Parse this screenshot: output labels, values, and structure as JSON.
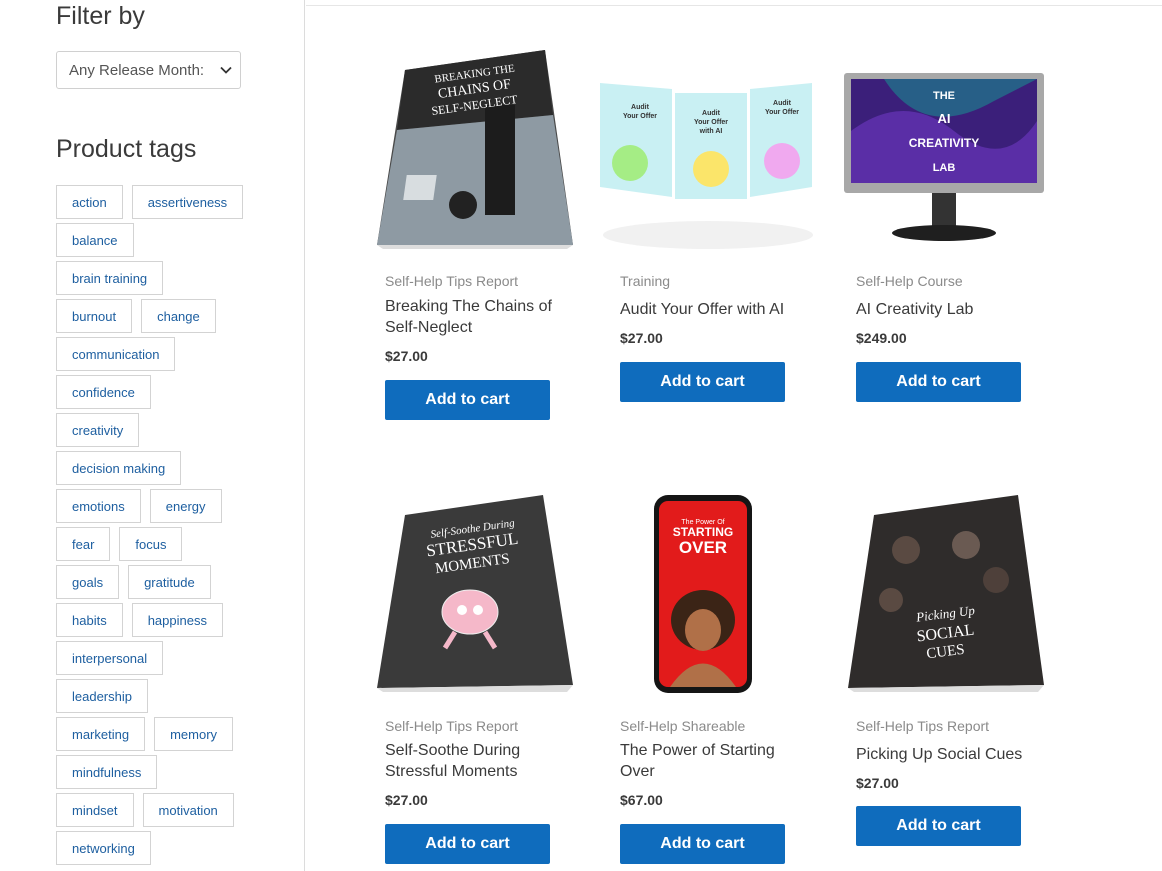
{
  "filter": {
    "title": "Filter by",
    "select_value": "Any Release Month:"
  },
  "tags": {
    "title": "Product tags",
    "rows": [
      [
        "action",
        "assertiveness"
      ],
      [
        "balance"
      ],
      [
        "brain training"
      ],
      [
        "burnout",
        "change"
      ],
      [
        "communication"
      ],
      [
        "confidence"
      ],
      [
        "creativity"
      ],
      [
        "decision making"
      ],
      [
        "emotions",
        "energy"
      ],
      [
        "fear",
        "focus"
      ],
      [
        "goals",
        "gratitude"
      ],
      [
        "habits",
        "happiness"
      ],
      [
        "interpersonal"
      ],
      [
        "leadership"
      ],
      [
        "marketing",
        "memory"
      ],
      [
        "mindfulness"
      ],
      [
        "mindset",
        "motivation"
      ],
      [
        "networking"
      ]
    ]
  },
  "products": [
    {
      "category": "Self-Help Tips Report",
      "name": "Breaking The Chains of Self-Neglect",
      "price": "$27.00",
      "button": "Add to cart",
      "cover_text": "BREAKING THE CHAINS OF SELF-NEGLECT"
    },
    {
      "category": "Training",
      "name": "Audit Your Offer with AI",
      "price": "$27.00",
      "button": "Add to cart",
      "cover_text": "Audit Your Offer with AI"
    },
    {
      "category": "Self-Help Course",
      "name": "AI Creativity Lab",
      "price": "$249.00",
      "button": "Add to cart",
      "cover_text": "THE AI CREATIVITY LAB"
    },
    {
      "category": "Self-Help Tips Report",
      "name": "Self-Soothe During Stressful Moments",
      "price": "$27.00",
      "button": "Add to cart",
      "cover_text": "Self-Soothe During STRESSFUL MOMENTS"
    },
    {
      "category": "Self-Help Shareable",
      "name": "The Power of Starting Over",
      "price": "$67.00",
      "button": "Add to cart",
      "cover_text": "STARTING OVER"
    },
    {
      "category": "Self-Help Tips Report",
      "name": "Picking Up Social Cues",
      "price": "$27.00",
      "button": "Add to cart",
      "cover_text": "Picking Up SOCIAL CUES"
    }
  ],
  "colors": {
    "button": "#0f6cbd",
    "tag_text": "#1e5fa0"
  }
}
